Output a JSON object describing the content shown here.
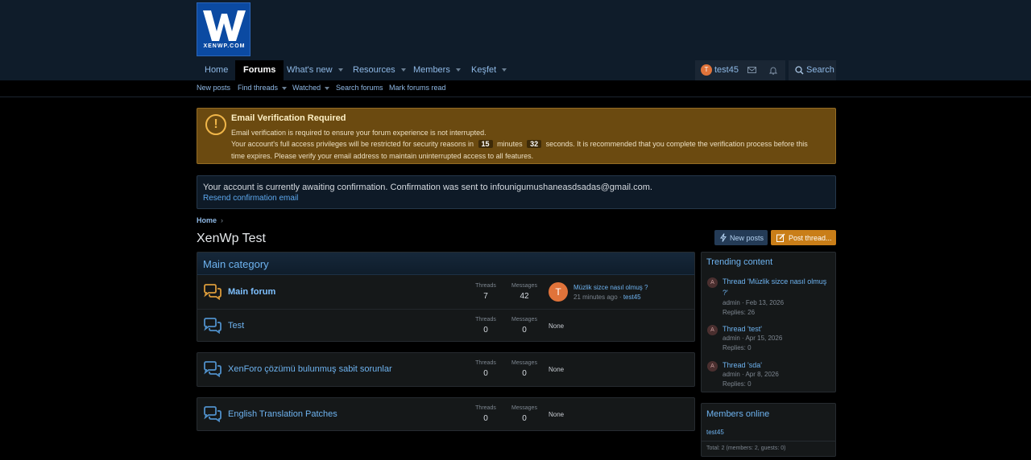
{
  "site": {
    "logo_text": "XENWP.COM"
  },
  "nav": {
    "tabs": [
      {
        "label": "Home"
      },
      {
        "label": "Forums"
      },
      {
        "label": "What's new"
      },
      {
        "label": "Resources"
      },
      {
        "label": "Members"
      },
      {
        "label": "Keşfet"
      }
    ],
    "user": {
      "avatar_letter": "T",
      "name": "test45"
    },
    "search_label": "Search"
  },
  "subnav": {
    "links": [
      {
        "label": "New posts"
      },
      {
        "label": "Find threads"
      },
      {
        "label": "Watched"
      },
      {
        "label": "Search forums"
      },
      {
        "label": "Mark forums read"
      }
    ]
  },
  "warning": {
    "title": "Email Verification Required",
    "line1": "Email verification is required to ensure your forum experience is not interrupted.",
    "line2_pre": "Your account's full access privileges will be restricted for security reasons in",
    "minutes": "15",
    "minutes_word": "minutes",
    "seconds": "32",
    "line2_post": "seconds. It is recommended that you complete the verification process before this",
    "line3": "time expires. Please verify your email address to maintain uninterrupted access to all features."
  },
  "info": {
    "text": "Your account is currently awaiting confirmation. Confirmation was sent to infounigumushaneasdsadas@gmail.com.",
    "link": "Resend confirmation email"
  },
  "breadcrumb": {
    "home": "Home",
    "sep": "›"
  },
  "page": {
    "title": "XenWp Test",
    "new_posts_label": "New posts",
    "post_thread_label": "Post thread..."
  },
  "categories": [
    {
      "title": "Main category",
      "forums": [
        {
          "title": "Main forum",
          "threads_label": "Threads",
          "threads": "7",
          "messages_label": "Messages",
          "messages": "42",
          "last_post": {
            "avatar": "T",
            "title": "Müzlik sizce nasıl olmuş ?",
            "time": "21 minutes ago",
            "dot": " · ",
            "user": "test45"
          }
        },
        {
          "title": "Test",
          "threads_label": "Threads",
          "threads": "0",
          "messages_label": "Messages",
          "messages": "0",
          "none": "None"
        }
      ]
    },
    {
      "forums": [
        {
          "title": "XenForo çözümü bulunmuş sabit sorunlar",
          "threads_label": "Threads",
          "threads": "0",
          "messages_label": "Messages",
          "messages": "0",
          "none": "None"
        }
      ]
    },
    {
      "forums": [
        {
          "title": "English Translation Patches",
          "threads_label": "Threads",
          "threads": "0",
          "messages_label": "Messages",
          "messages": "0",
          "none": "None"
        }
      ]
    }
  ],
  "trending": {
    "title": "Trending content",
    "items": [
      {
        "avatar": "A",
        "title": "Thread 'Müzlik sizce nasıl olmuş ?'",
        "meta": "admin · Feb 13, 2026",
        "replies": "Replies: 26"
      },
      {
        "avatar": "A",
        "title": "Thread 'test'",
        "meta": "admin · Apr 15, 2026",
        "replies": "Replies: 0"
      },
      {
        "avatar": "A",
        "title": "Thread 'sda'",
        "meta": "admin · Apr 8, 2026",
        "replies": "Replies: 0"
      }
    ]
  },
  "members_online": {
    "title": "Members online",
    "users": [
      "test45"
    ],
    "total": "Total: 2 (members: 2, guests: 0)"
  }
}
